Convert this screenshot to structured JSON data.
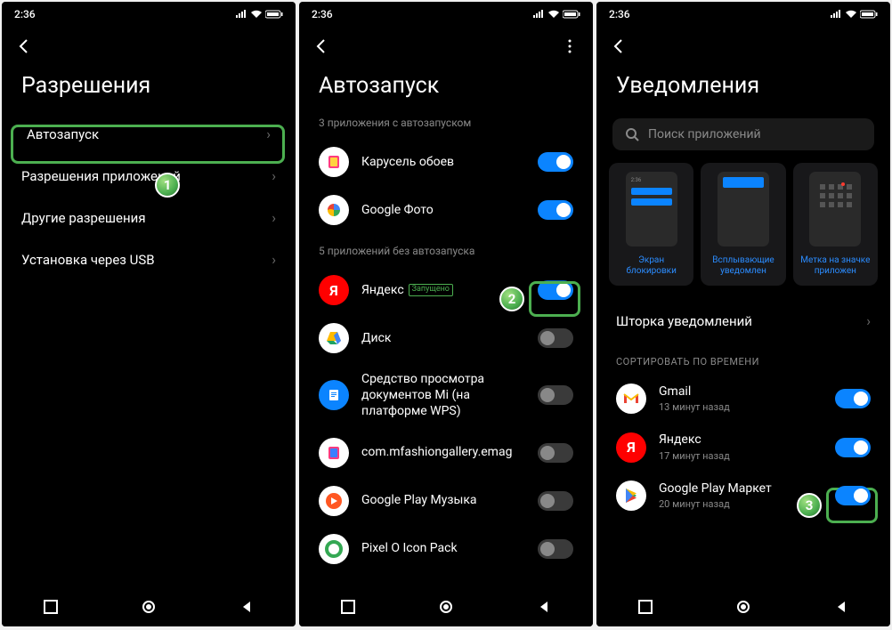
{
  "statusbar": {
    "time": "2:36"
  },
  "screen1": {
    "title": "Разрешения",
    "items": [
      {
        "label": "Автозапуск"
      },
      {
        "label": "Разрешения приложений"
      },
      {
        "label": "Другие разрешения"
      },
      {
        "label": "Установка через USB"
      }
    ]
  },
  "screen2": {
    "title": "Автозапуск",
    "sub_on": "3 приложения с автозапуском",
    "sub_off": "5 приложений без автозапуска",
    "on_apps": [
      {
        "label": "Карусель обоев"
      },
      {
        "label": "Google Фото"
      }
    ],
    "yandex": {
      "label": "Яндекс",
      "tag": "Запущено"
    },
    "off_apps": [
      {
        "label": "Диск"
      },
      {
        "label": "Средство просмотра документов Mi (на платформе WPS)"
      },
      {
        "label": "com.mfashiongallery.emag"
      },
      {
        "label": "Google Play Музыка"
      },
      {
        "label": "Pixel O Icon Pack"
      }
    ]
  },
  "screen3": {
    "title": "Уведомления",
    "search_placeholder": "Поиск приложений",
    "cards": [
      {
        "label": "Экран блокировки"
      },
      {
        "label": "Всплывающие уведомлен"
      },
      {
        "label": "Метка на значке приложен"
      }
    ],
    "shade": "Шторка уведомлений",
    "sort": "СОРТИРОВАТЬ ПО ВРЕМЕНИ",
    "apps": [
      {
        "label": "Gmail",
        "sub": "13 минут назад"
      },
      {
        "label": "Яндекс",
        "sub": "17 минут назад"
      },
      {
        "label": "Google Play Маркет",
        "sub": "20 минут назад"
      }
    ]
  },
  "badges": {
    "b1": "1",
    "b2": "2",
    "b3": "3"
  }
}
